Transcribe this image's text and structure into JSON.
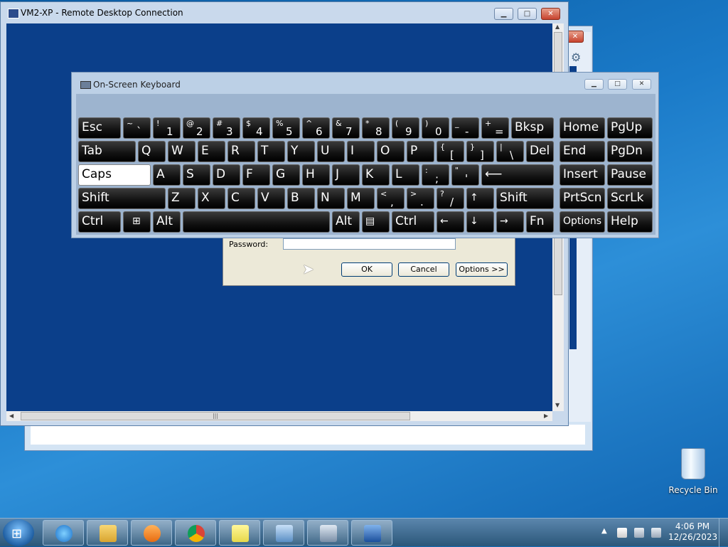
{
  "rdp_window": {
    "title": "VM2-XP - Remote Desktop Connection",
    "minimize": "▁",
    "maximize": "□",
    "close": "✕",
    "scroll_grip": "|||"
  },
  "login_dialog": {
    "password_label": "Password:",
    "password_value": "",
    "ok_label": "OK",
    "cancel_label": "Cancel",
    "options_label": "Options >>"
  },
  "osk": {
    "title": "On-Screen Keyboard",
    "minimize": "▁",
    "maximize": "□",
    "close": "✕",
    "keys": {
      "esc": "Esc",
      "grave_shift": "~",
      "grave_base": "`",
      "k1_shift": "!",
      "k1_base": "1",
      "k2_shift": "@",
      "k2_base": "2",
      "k3_shift": "#",
      "k3_base": "3",
      "k4_shift": "$",
      "k4_base": "4",
      "k5_shift": "%",
      "k5_base": "5",
      "k6_shift": "^",
      "k6_base": "6",
      "k7_shift": "&",
      "k7_base": "7",
      "k8_shift": "*",
      "k8_base": "8",
      "k9_shift": "(",
      "k9_base": "9",
      "k0_shift": ")",
      "k0_base": "0",
      "minus_shift": "_",
      "minus_base": "-",
      "equal_shift": "+",
      "equal_base": "=",
      "bksp": "Bksp",
      "home": "Home",
      "pgup": "PgUp",
      "tab": "Tab",
      "q": "Q",
      "w": "W",
      "e": "E",
      "r": "R",
      "t": "T",
      "y": "Y",
      "u": "U",
      "i": "I",
      "o": "O",
      "p": "P",
      "lbracket_shift": "{",
      "lbracket_base": "[",
      "rbracket_shift": "}",
      "rbracket_base": "]",
      "backslash_shift": "|",
      "backslash_base": "\\",
      "del": "Del",
      "end": "End",
      "pgdn": "PgDn",
      "caps": "Caps",
      "a": "A",
      "s": "S",
      "d": "D",
      "f": "F",
      "g": "G",
      "h": "H",
      "j": "J",
      "k": "K",
      "l": "L",
      "semicolon_shift": ":",
      "semicolon_base": ";",
      "quote_shift": "\"",
      "quote_base": "'",
      "enter": "⟵",
      "insert": "Insert",
      "pause": "Pause",
      "lshift": "Shift",
      "z": "Z",
      "x": "X",
      "c": "C",
      "v": "V",
      "b": "B",
      "n": "N",
      "m": "M",
      "comma_shift": "<",
      "comma_base": ",",
      "period_shift": ">",
      "period_base": ".",
      "slash_shift": "?",
      "slash_base": "/",
      "up": "↑",
      "rshift": "Shift",
      "prtscn": "PrtScn",
      "scrlk": "ScrLk",
      "lctrl": "Ctrl",
      "win": "⊞",
      "lalt": "Alt",
      "ralt": "Alt",
      "menu": "▤",
      "rctrl": "Ctrl",
      "left": "←",
      "down": "↓",
      "right": "→",
      "fn": "Fn",
      "options": "Options",
      "help": "Help"
    },
    "caps_active": true
  },
  "desktop": {
    "recycle_bin_label": "Recycle Bin"
  },
  "taskbar": {
    "start_glyph": "⊞",
    "items": [
      "internet-explorer",
      "file-explorer",
      "media-player",
      "chrome",
      "sticky-notes",
      "control-panel",
      "on-screen-keyboard",
      "remote-desktop"
    ],
    "tray_arrow": "▲",
    "time": "4:06 PM",
    "date": "12/26/2023"
  }
}
